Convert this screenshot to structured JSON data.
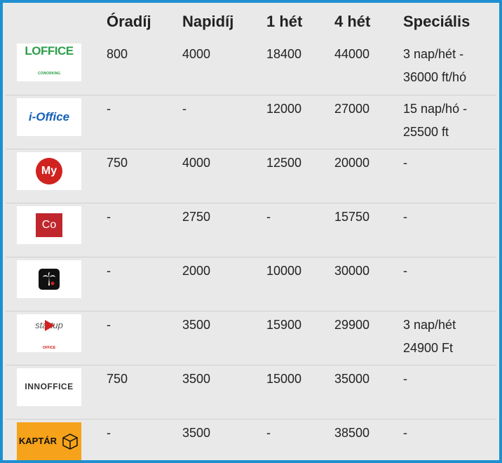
{
  "headers": {
    "logo": "",
    "oradij": "Óradíj",
    "napidij": "Napidíj",
    "het1": "1 hét",
    "het4": "4 hét",
    "specialis": "Speciális"
  },
  "rows": [
    {
      "logo": {
        "name": "loffice-logo",
        "text": "LOFFICE",
        "subtext": "COWORKING",
        "accent": "#2e9e4b"
      },
      "oradij": "800",
      "napidij": "4000",
      "het1": "18400",
      "het4": "44000",
      "specialis_line1": "3 nap/hét -",
      "specialis_line2": "36000 ft/hó"
    },
    {
      "logo": {
        "name": "ioffice-logo",
        "text": "i-Office",
        "accent": "#1460b8"
      },
      "oradij": "-",
      "napidij": "-",
      "het1": "12000",
      "het4": "27000",
      "specialis_line1": "15 nap/hó -",
      "specialis_line2": "25500 ft"
    },
    {
      "logo": {
        "name": "my-office-logo",
        "text": "My",
        "accent": "#d0221f"
      },
      "oradij": "750",
      "napidij": "4000",
      "het1": "12500",
      "het4": "20000",
      "specialis_line1": "-",
      "specialis_line2": ""
    },
    {
      "logo": {
        "name": "co-logo",
        "text": "Co",
        "accent": "#c0272d"
      },
      "oradij": "-",
      "napidij": "2750",
      "het1": "-",
      "het4": "15750",
      "specialis_line1": "-",
      "specialis_line2": ""
    },
    {
      "logo": {
        "name": "palm-logo",
        "text": "",
        "accent": "#111111"
      },
      "oradij": "-",
      "napidij": "2000",
      "het1": "10000",
      "het4": "30000",
      "specialis_line1": "-",
      "specialis_line2": ""
    },
    {
      "logo": {
        "name": "startup-office-logo",
        "text": "startup",
        "subtext": "OFFICE",
        "accent": "#d0221f"
      },
      "oradij": "-",
      "napidij": "3500",
      "het1": "15900",
      "het4": "29900",
      "specialis_line1": "3 nap/hét",
      "specialis_line2": "24900 Ft"
    },
    {
      "logo": {
        "name": "innoffice-logo",
        "text": "INNOFFICE",
        "accent": "#333333"
      },
      "oradij": "750",
      "napidij": "3500",
      "het1": "15000",
      "het4": "35000",
      "specialis_line1": "-",
      "specialis_line2": ""
    },
    {
      "logo": {
        "name": "kaptar-logo",
        "text": "KAPTÁR",
        "accent": "#f6a21a"
      },
      "oradij": "-",
      "napidij": "3500",
      "het1": "-",
      "het4": "38500",
      "specialis_line1": "-",
      "specialis_line2": ""
    }
  ]
}
